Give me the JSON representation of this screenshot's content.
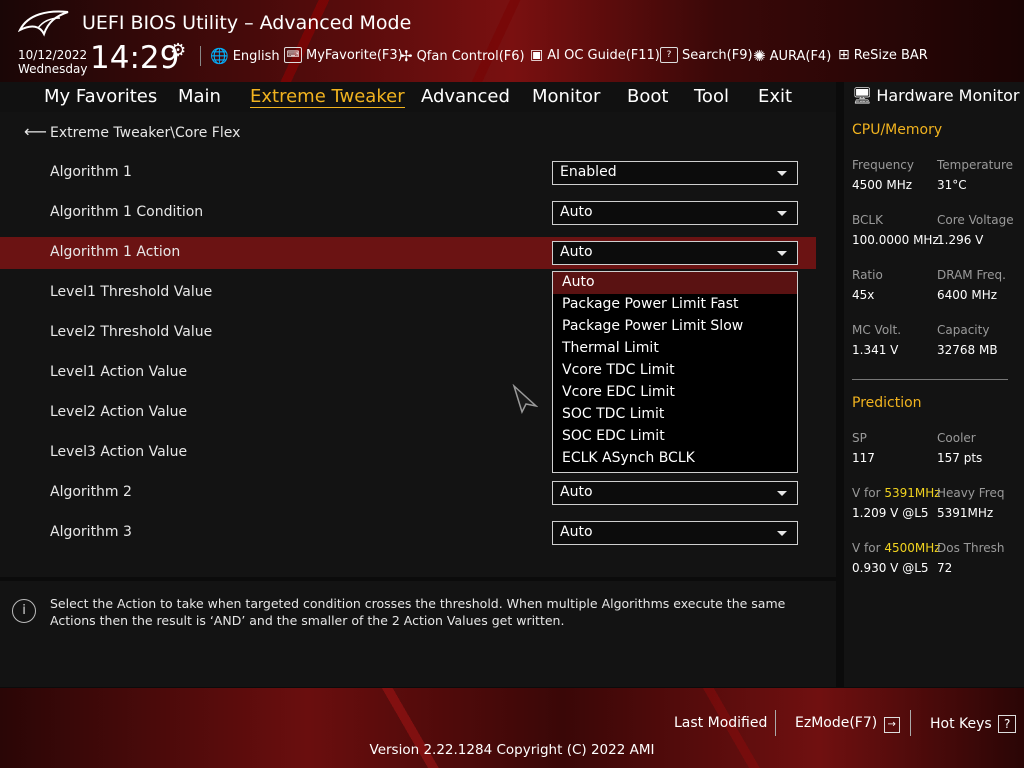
{
  "header": {
    "title": "UEFI BIOS Utility – Advanced Mode",
    "date": "10/12/2022",
    "weekday": "Wednesday",
    "time": "14:29",
    "toolbar": [
      {
        "icon": "globe-icon",
        "label": "English"
      },
      {
        "icon": "keyboard-icon",
        "label": "MyFavorite(F3)"
      },
      {
        "icon": "fan-icon",
        "label": "Qfan Control(F6)"
      },
      {
        "icon": "chip-icon",
        "label": "AI OC Guide(F11)"
      },
      {
        "icon": "search-icon",
        "label": "Search(F9)"
      },
      {
        "icon": "aura-icon",
        "label": "AURA(F4)"
      },
      {
        "icon": "resize-bar-icon",
        "label": "ReSize BAR"
      }
    ]
  },
  "nav": {
    "tabs": [
      "My Favorites",
      "Main",
      "Extreme Tweaker",
      "Advanced",
      "Monitor",
      "Boot",
      "Tool",
      "Exit"
    ],
    "active": "Extreme Tweaker"
  },
  "breadcrumb": "Extreme Tweaker\\Core Flex",
  "settings": [
    {
      "label": "Algorithm 1",
      "value": "Enabled"
    },
    {
      "label": "Algorithm 1 Condition",
      "value": "Auto"
    },
    {
      "label": "Algorithm 1 Action",
      "value": "Auto"
    },
    {
      "label": "Level1 Threshold Value",
      "value": ""
    },
    {
      "label": "Level2 Threshold Value",
      "value": ""
    },
    {
      "label": "Level1 Action Value",
      "value": ""
    },
    {
      "label": "Level2 Action Value",
      "value": ""
    },
    {
      "label": "Level3 Action Value",
      "value": ""
    },
    {
      "label": "Algorithm 2",
      "value": "Auto"
    },
    {
      "label": "Algorithm 3",
      "value": "Auto"
    }
  ],
  "dropdown_options": [
    "Auto",
    "Package Power Limit Fast",
    "Package Power Limit Slow",
    "Thermal Limit",
    "Vcore TDC Limit",
    "Vcore EDC Limit",
    "SOC TDC Limit",
    "SOC EDC Limit",
    "ECLK ASynch BCLK"
  ],
  "help_text": "Select the Action to take when targeted condition crosses the threshold. When multiple Algorithms execute the same Actions then the result is ‘AND’ and the smaller of the 2 Action Values get written.",
  "hw_monitor": {
    "title": "Hardware Monitor",
    "cpu_section": "CPU/Memory",
    "cpu": [
      {
        "k": "Frequency",
        "v": "4500 MHz"
      },
      {
        "k": "Temperature",
        "v": "31°C"
      },
      {
        "k": "BCLK",
        "v": "100.0000 MHz"
      },
      {
        "k": "Core Voltage",
        "v": "1.296 V"
      },
      {
        "k": "Ratio",
        "v": "45x"
      },
      {
        "k": "DRAM Freq.",
        "v": "6400 MHz"
      },
      {
        "k": "MC Volt.",
        "v": "1.341 V"
      },
      {
        "k": "Capacity",
        "v": "32768 MB"
      }
    ],
    "prediction_section": "Prediction",
    "prediction": [
      {
        "k": "SP",
        "v": "117"
      },
      {
        "k": "Cooler",
        "v": "157 pts"
      },
      {
        "k_prefix": "V for ",
        "k_hl": "5391MHz",
        "v": "1.209 V @L5"
      },
      {
        "k": "Heavy Freq",
        "v": "5391MHz"
      },
      {
        "k_prefix": "V for ",
        "k_hl": "4500MHz",
        "v": "0.930 V @L5"
      },
      {
        "k": "Dos Thresh",
        "v": "72"
      }
    ]
  },
  "footer": {
    "last_modified": "Last Modified",
    "ezmode": "EzMode(F7)",
    "hotkeys": "Hot Keys",
    "version": "Version 2.22.1284 Copyright (C) 2022 AMI"
  },
  "colors": {
    "accent": "#f1b31f",
    "highlight_row": "#6b1313",
    "selected_option": "#5a1212"
  }
}
